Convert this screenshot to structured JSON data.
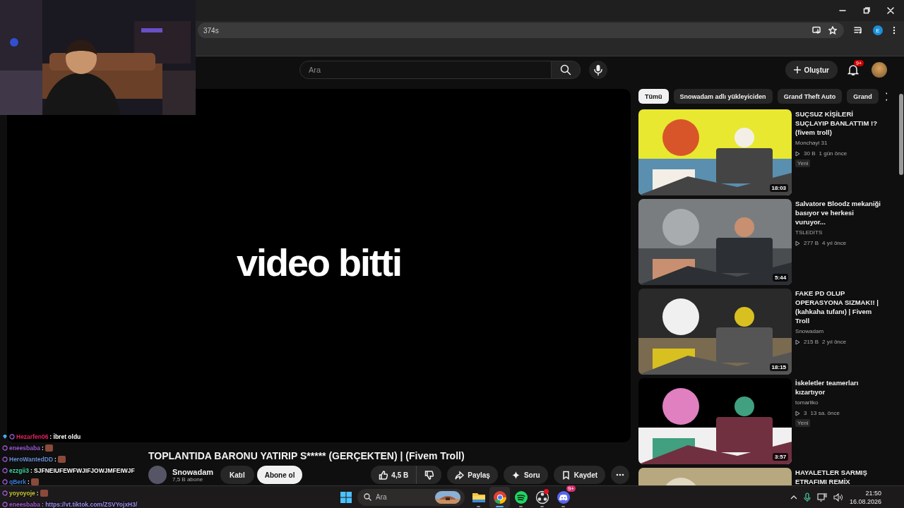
{
  "browser": {
    "address": "374s",
    "profile_initial": "E"
  },
  "masthead": {
    "search_placeholder": "Ara",
    "create_label": "Oluştur",
    "notification_badge": "9+"
  },
  "player": {
    "overlay_text": "video bitti"
  },
  "video": {
    "title": "TOPLANTIDA BARONU YATIRIP S***** (GERÇEKTEN) | (Fivem Troll)",
    "channel": "Snowadam",
    "subscribers": "7,5 B abone",
    "join_label": "Katıl",
    "subscribe_label": "Abone ol",
    "likes": "4,5 B",
    "actions": [
      {
        "kind": "share",
        "label": "Paylaş"
      },
      {
        "kind": "ask",
        "label": "Soru"
      },
      {
        "kind": "save",
        "label": "Kaydet"
      }
    ]
  },
  "chips": [
    {
      "label": "Tümü",
      "selected": true
    },
    {
      "label": "Snowadam adlı yükleyiciden",
      "selected": false
    },
    {
      "label": "Grand Theft Auto",
      "selected": false
    },
    {
      "label": "Grand",
      "selected": false
    }
  ],
  "recommendations": [
    {
      "title": "SUÇSUZ KİŞİLERİ SUÇLAYIP BANLATTIM !? (fivem troll)",
      "channel": "Monchayi 31",
      "views": "30 B",
      "age": "1 gün önce",
      "badge": "Yeni",
      "duration": "18:03"
    },
    {
      "title": "Salvatore Bloodz mekaniği basıyor ve herkesi vuruyor...",
      "channel": "TSLEDİTS",
      "views": "277 B",
      "age": "4 yıl önce",
      "duration": "5:44"
    },
    {
      "title": "FAKE PD OLUP OPERASYONA SIZMAK!! | (kahkaha tufanı) | Fivem Troll",
      "channel": "Snowadam",
      "views": "215 B",
      "age": "2 yıl önce",
      "duration": "18:15"
    },
    {
      "title": "İskeletler teamerları kızartıyor",
      "channel": "tomarliko",
      "views": "3",
      "age": "13 sa. önce",
      "badge": "Yeni",
      "duration": "3:57"
    },
    {
      "title": "HAYALETLER SARMIŞ ETRAFIMI REMİX"
    }
  ],
  "chat": [
    {
      "user": "Hezarfen06",
      "color": "#e0245e",
      "message": ": İbret oldu",
      "gem": true
    },
    {
      "user": "eneesbaba",
      "color": "#9b59d0",
      "message": ":",
      "emote": true
    },
    {
      "user": "HeroWantedDD",
      "color": "#6a8fd8",
      "message": ":",
      "emote": true
    },
    {
      "user": "ezzgii3",
      "color": "#3fd6a0",
      "message": ": SJFNEIUFEWFWJIFJOWJMFEIWJF"
    },
    {
      "user": "qBerk",
      "color": "#3a7bd5",
      "message": ":",
      "emote": true
    },
    {
      "user": "yoyoyoje",
      "color": "#c8c83a",
      "message": ":",
      "emote": true
    },
    {
      "user": "eneesbaba",
      "color": "#9b59d0",
      "message": ": https://vt.tiktok.com/ZSVYojxH3/",
      "link": true
    }
  ],
  "taskbar": {
    "search_placeholder": "Ara",
    "apps": [
      {
        "kind": "files",
        "active": false
      },
      {
        "kind": "chrome",
        "active": true
      },
      {
        "kind": "spotify",
        "active": false
      },
      {
        "kind": "obs",
        "active": false,
        "alert": true
      },
      {
        "kind": "discord",
        "active": false,
        "badge": "9+"
      }
    ],
    "time": "21:50",
    "date": "16.08.2026"
  }
}
